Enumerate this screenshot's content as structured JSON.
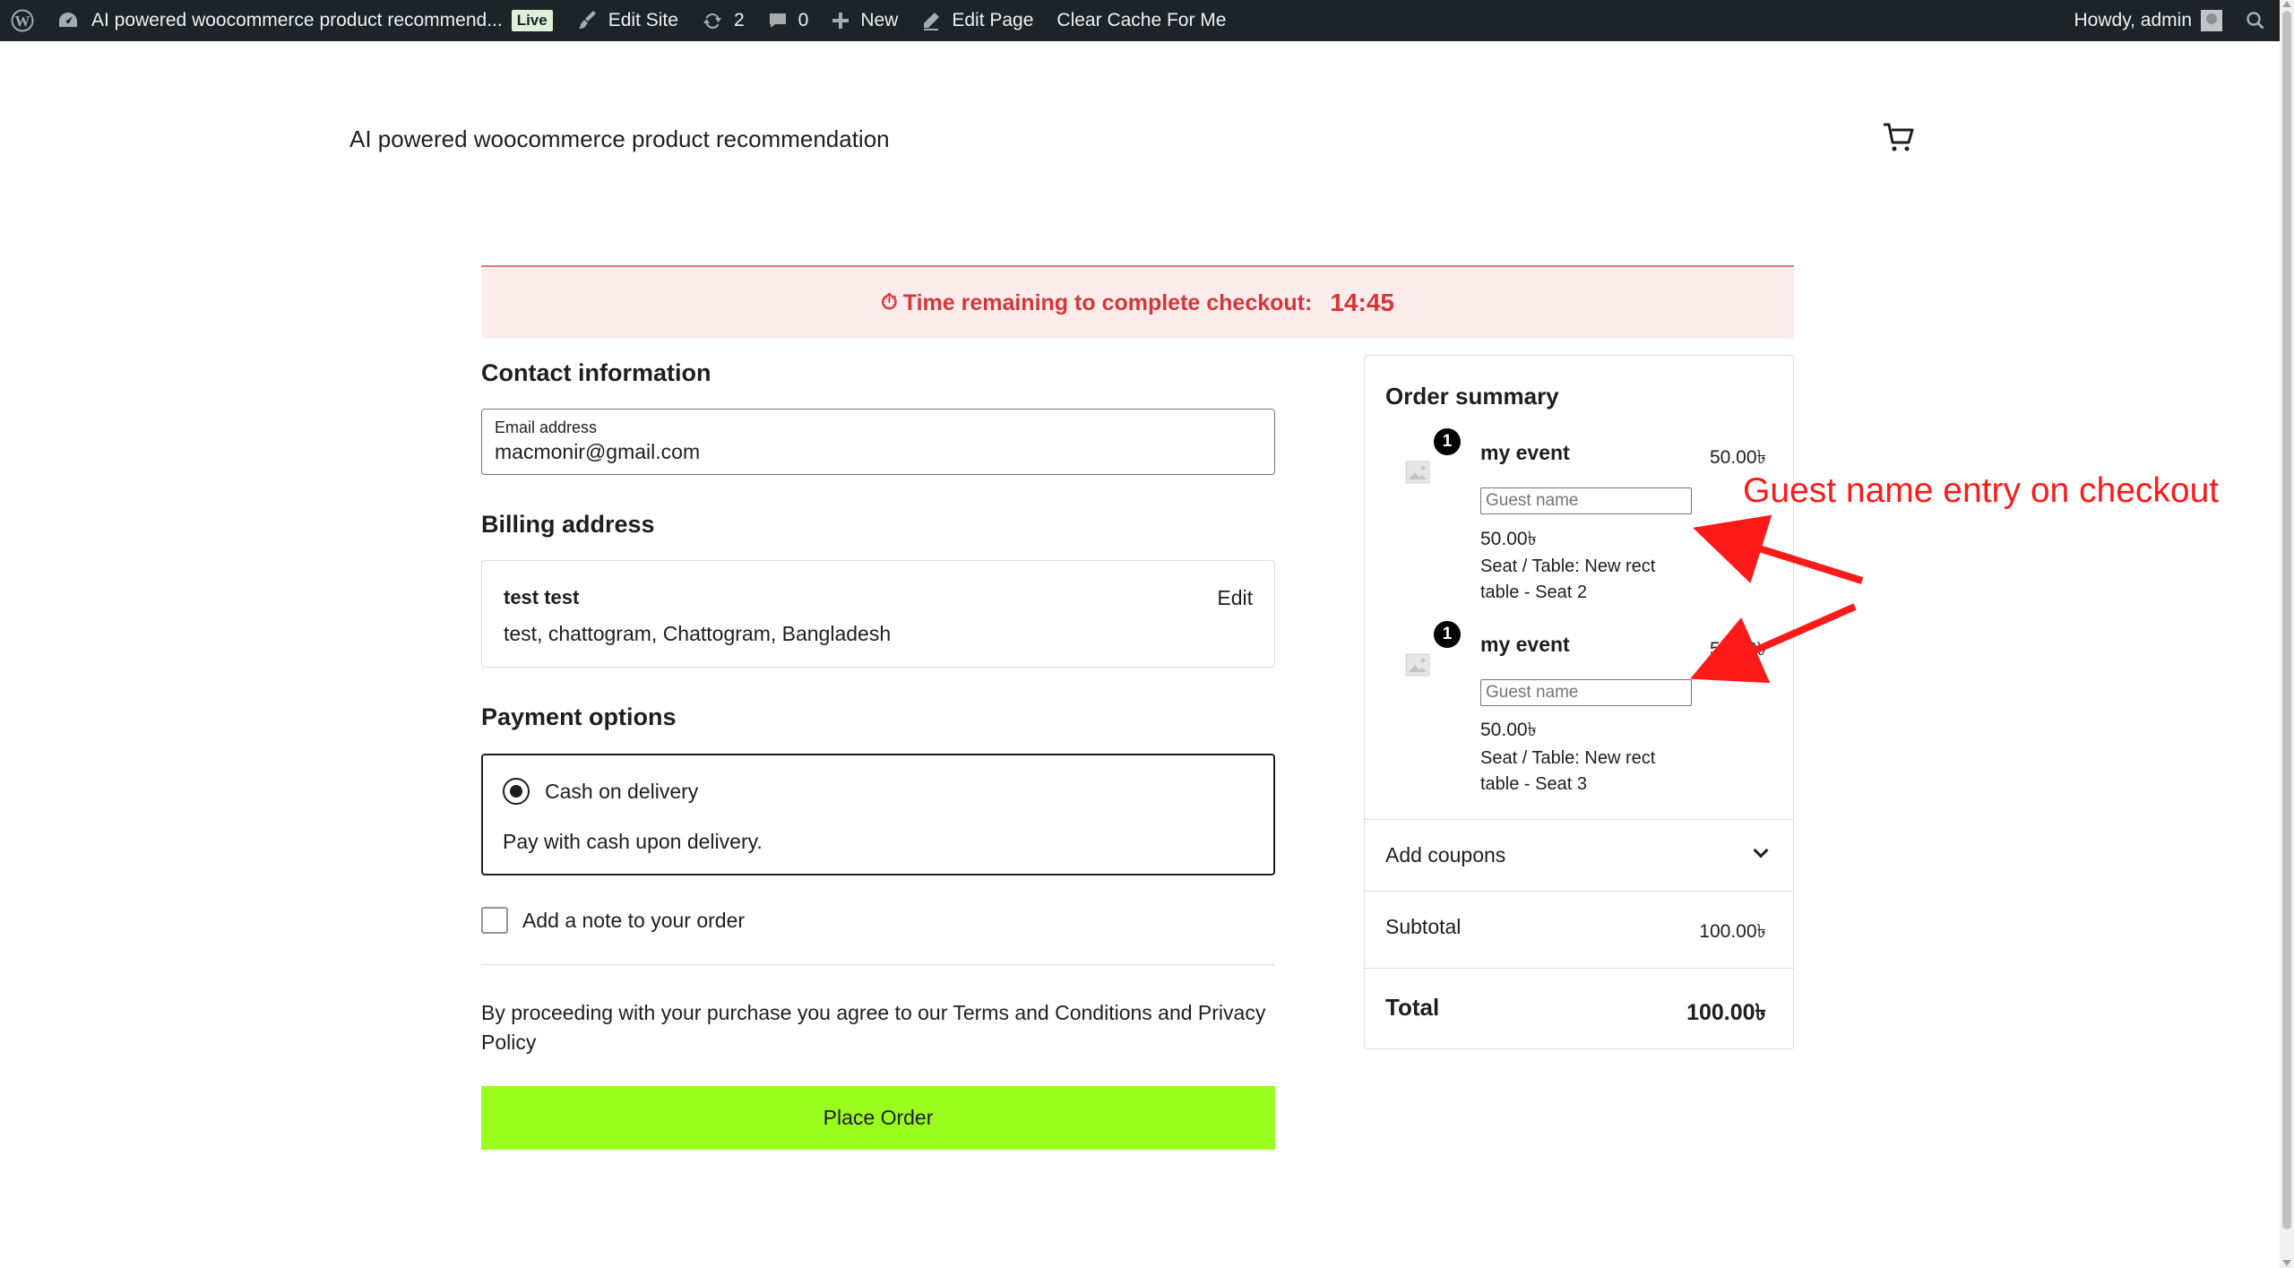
{
  "admin_bar": {
    "site_name": "AI powered woocommerce product recommend...",
    "live_badge": "Live",
    "edit_site": "Edit Site",
    "updates_count": "2",
    "comments_count": "0",
    "new_label": "New",
    "edit_page": "Edit Page",
    "clear_cache": "Clear Cache For Me",
    "howdy": "Howdy, admin"
  },
  "site": {
    "title": "AI powered woocommerce product recommendation"
  },
  "timer": {
    "label": "Time remaining to complete checkout:",
    "time": "14:45",
    "color": "#d63638",
    "background": "#fdecec"
  },
  "contact": {
    "title": "Contact information",
    "email_label": "Email address",
    "email_value": "macmonir@gmail.com"
  },
  "billing": {
    "title": "Billing address",
    "name": "test test",
    "address": "test, chattogram, Chattogram, Bangladesh",
    "edit_label": "Edit"
  },
  "payment": {
    "title": "Payment options",
    "method_label": "Cash on delivery",
    "method_desc": "Pay with cash upon delivery."
  },
  "note": {
    "label": "Add a note to your order"
  },
  "terms": {
    "text": "By proceeding with your purchase you agree to our Terms and Conditions and Privacy Policy"
  },
  "place_order": {
    "label": "Place Order",
    "color": "#9afd1e"
  },
  "summary": {
    "title": "Order summary",
    "items": [
      {
        "qty": "1",
        "name": "my event",
        "price": "50.00৳",
        "guest_placeholder": "Guest name",
        "sub_price": "50.00৳",
        "meta": "Seat / Table: New rect table - Seat 2"
      },
      {
        "qty": "1",
        "name": "my event",
        "price": "50.00৳",
        "guest_placeholder": "Guest name",
        "sub_price": "50.00৳",
        "meta": "Seat / Table: New rect table - Seat 3"
      }
    ],
    "coupons_label": "Add coupons",
    "subtotal_label": "Subtotal",
    "subtotal_value": "100.00৳",
    "total_label": "Total",
    "total_value": "100.00৳"
  },
  "annotation": {
    "text": "Guest name entry on checkout",
    "color": "#ff1a1a"
  },
  "icons": {
    "wp": "wordpress-icon",
    "dashboard": "dashboard-icon",
    "edit_site": "brush-icon",
    "updates": "refresh-icon",
    "comments": "comment-icon",
    "new": "plus-icon",
    "edit_page": "pencil-icon",
    "search": "search-icon",
    "cart": "cart-icon",
    "timer": "stopwatch-icon",
    "chevron": "chevron-down-icon",
    "placeholder_image": "image-placeholder-icon"
  }
}
